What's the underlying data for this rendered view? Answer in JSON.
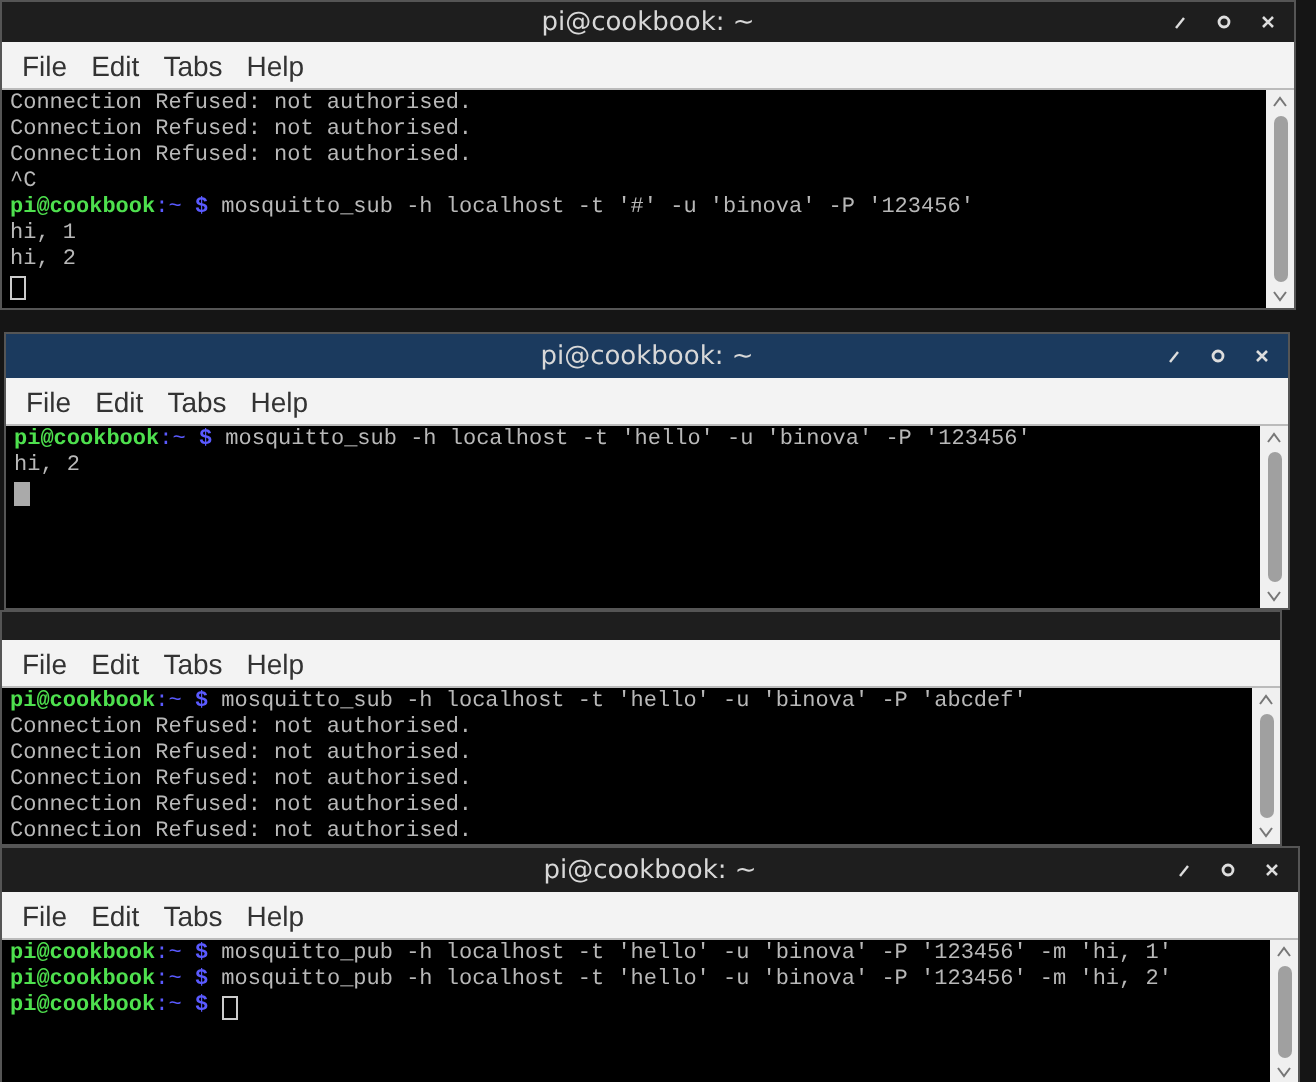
{
  "windows": [
    {
      "title": "pi@cookbook: ~",
      "active": false,
      "menu": [
        "File",
        "Edit",
        "Tabs",
        "Help"
      ],
      "lines": [
        {
          "kind": "output",
          "text": "Connection Refused: not authorised."
        },
        {
          "kind": "output",
          "text": "Connection Refused: not authorised."
        },
        {
          "kind": "output",
          "text": "Connection Refused: not authorised."
        },
        {
          "kind": "output",
          "text": "^C"
        },
        {
          "kind": "prompt",
          "user": "pi@cookbook",
          "path": ":~",
          "sign": "$",
          "command": "mosquitto_sub -h localhost -t '#' -u 'binova' -P '123456'"
        },
        {
          "kind": "output",
          "text": "hi, 1"
        },
        {
          "kind": "output",
          "text": "hi, 2"
        },
        {
          "kind": "cursor"
        }
      ]
    },
    {
      "title": "pi@cookbook: ~",
      "active": true,
      "menu": [
        "File",
        "Edit",
        "Tabs",
        "Help"
      ],
      "lines": [
        {
          "kind": "prompt",
          "user": "pi@cookbook",
          "path": ":~",
          "sign": "$",
          "command": "mosquitto_sub -h localhost -t 'hello' -u 'binova' -P '123456'"
        },
        {
          "kind": "output",
          "text": "hi, 2"
        },
        {
          "kind": "cursor"
        }
      ]
    },
    {
      "active": false,
      "menu": [
        "File",
        "Edit",
        "Tabs",
        "Help"
      ],
      "lines": [
        {
          "kind": "prompt",
          "user": "pi@cookbook",
          "path": ":~",
          "sign": "$",
          "command": "mosquitto_sub -h localhost -t 'hello' -u 'binova' -P 'abcdef'"
        },
        {
          "kind": "output",
          "text": "Connection Refused: not authorised."
        },
        {
          "kind": "output",
          "text": "Connection Refused: not authorised."
        },
        {
          "kind": "output",
          "text": "Connection Refused: not authorised."
        },
        {
          "kind": "output",
          "text": "Connection Refused: not authorised."
        },
        {
          "kind": "output",
          "text": "Connection Refused: not authorised."
        }
      ]
    },
    {
      "title": "pi@cookbook: ~",
      "active": false,
      "menu": [
        "File",
        "Edit",
        "Tabs",
        "Help"
      ],
      "lines": [
        {
          "kind": "prompt",
          "user": "pi@cookbook",
          "path": ":~",
          "sign": "$",
          "command": "mosquitto_pub -h localhost -t 'hello' -u 'binova' -P '123456' -m 'hi, 1'"
        },
        {
          "kind": "prompt",
          "user": "pi@cookbook",
          "path": ":~",
          "sign": "$",
          "command": "mosquitto_pub -h localhost -t 'hello' -u 'binova' -P '123456' -m 'hi, 2'"
        },
        {
          "kind": "prompt",
          "user": "pi@cookbook",
          "path": ":~",
          "sign": "$",
          "cursor": true
        }
      ]
    }
  ]
}
